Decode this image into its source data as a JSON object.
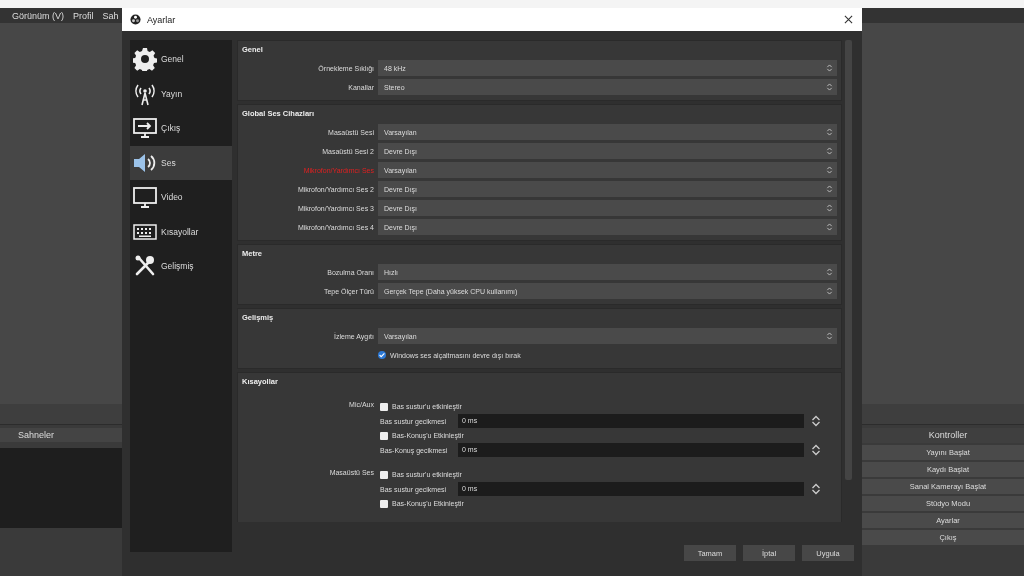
{
  "menu": [
    "Görünüm (V)",
    "Profil",
    "Sah"
  ],
  "scenes_dock": {
    "title": "Sahneler"
  },
  "controls_dock": {
    "title": "Kontroller",
    "buttons": [
      "Yayını Başlat",
      "Kaydı Başlat",
      "Sanal Kamerayı Başlat",
      "Stüdyo Modu",
      "Ayarlar",
      "Çıkış"
    ]
  },
  "dialog": {
    "title": "Ayarlar",
    "nav": [
      {
        "label": "Genel",
        "selected": false
      },
      {
        "label": "Yayın",
        "selected": false
      },
      {
        "label": "Çıkış",
        "selected": false
      },
      {
        "label": "Ses",
        "selected": true
      },
      {
        "label": "Video",
        "selected": false
      },
      {
        "label": "Kısayollar",
        "selected": false
      },
      {
        "label": "Gelişmiş",
        "selected": false
      }
    ],
    "sections": [
      {
        "title": "Genel",
        "rows": [
          {
            "kind": "combo",
            "label": "Örnekleme Sıklığı",
            "value": "48 kHz",
            "warning": false
          },
          {
            "kind": "combo",
            "label": "Kanallar",
            "value": "Stereo",
            "warning": false
          }
        ]
      },
      {
        "title": "Global Ses Cihazları",
        "rows": [
          {
            "kind": "combo",
            "label": "Masaüstü Sesi",
            "value": "Varsayılan",
            "warning": false
          },
          {
            "kind": "combo",
            "label": "Masaüstü Sesi 2",
            "value": "Devre Dışı",
            "warning": false
          },
          {
            "kind": "combo",
            "label": "Mikrofon/Yardımcı Ses",
            "value": "Varsayılan",
            "warning": true
          },
          {
            "kind": "combo",
            "label": "Mikrofon/Yardımcı Ses 2",
            "value": "Devre Dışı",
            "warning": false
          },
          {
            "kind": "combo",
            "label": "Mikrofon/Yardımcı Ses 3",
            "value": "Devre Dışı",
            "warning": false
          },
          {
            "kind": "combo",
            "label": "Mikrofon/Yardımcı Ses 4",
            "value": "Devre Dışı",
            "warning": false
          }
        ]
      },
      {
        "title": "Metre",
        "rows": [
          {
            "kind": "combo",
            "label": "Bozulma Oranı",
            "value": "Hızlı",
            "warning": false
          },
          {
            "kind": "combo",
            "label": "Tepe Ölçer Türü",
            "value": "Gerçek Tepe (Daha yüksek CPU kullanımı)",
            "warning": false
          }
        ]
      },
      {
        "title": "Gelişmiş",
        "rows": [
          {
            "kind": "combo",
            "label": "İzleme Aygıtı",
            "value": "Varsayılan",
            "warning": false
          },
          {
            "kind": "checkbox",
            "label": "Windows ses alçaltmasını devre dışı bırak",
            "checked": true
          }
        ]
      }
    ],
    "hotkeys": {
      "title": "Kısayollar",
      "groups": [
        {
          "label": "Mic/Aux",
          "items": [
            {
              "kind": "checkbox",
              "label": "Bas sustur'u etkinleştir",
              "checked": false
            },
            {
              "kind": "spin",
              "label": "Bas sustur gecikmesi",
              "value": "0 ms"
            },
            {
              "kind": "checkbox",
              "label": "Bas-Konuş'u Etkinleştir",
              "checked": false
            },
            {
              "kind": "spin",
              "label": "Bas-Konuş gecikmesi",
              "value": "0 ms"
            }
          ]
        },
        {
          "label": "Masaüstü Ses",
          "items": [
            {
              "kind": "checkbox",
              "label": "Bas sustur'u etkinleştir",
              "checked": false
            },
            {
              "kind": "spin",
              "label": "Bas sustur gecikmesi",
              "value": "0 ms"
            },
            {
              "kind": "checkbox",
              "label": "Bas-Konuş'u Etkinleştir",
              "checked": false
            }
          ]
        }
      ]
    },
    "buttons": [
      "Tamam",
      "İptal",
      "Uygula"
    ]
  }
}
